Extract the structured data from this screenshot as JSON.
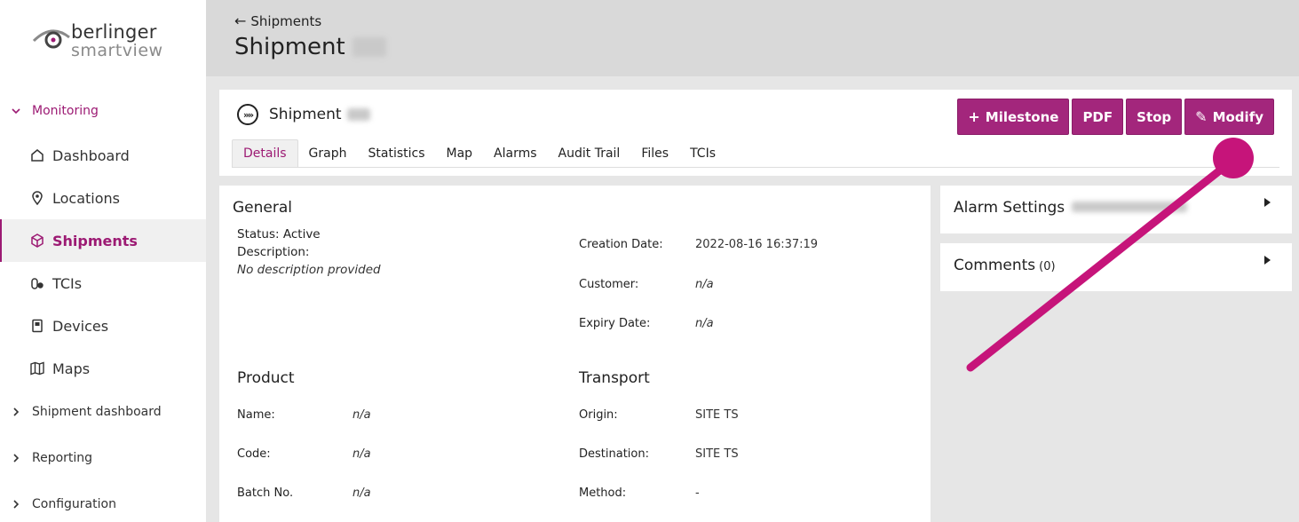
{
  "brand": {
    "word1": "berlinger",
    "word2": "smartview",
    "accent": "#9c1a73",
    "button": "#a3267c"
  },
  "sidebar": {
    "groups": [
      {
        "label": "Monitoring",
        "expanded": true
      },
      {
        "label": "Shipment dashboard",
        "expanded": false
      },
      {
        "label": "Reporting",
        "expanded": false
      },
      {
        "label": "Configuration",
        "expanded": false
      }
    ],
    "items": [
      {
        "label": "Dashboard",
        "icon": "home-icon"
      },
      {
        "label": "Locations",
        "icon": "location-pin-icon"
      },
      {
        "label": "Shipments",
        "icon": "package-icon",
        "active": true
      },
      {
        "label": "TCIs",
        "icon": "pills-icon"
      },
      {
        "label": "Devices",
        "icon": "device-icon"
      },
      {
        "label": "Maps",
        "icon": "map-icon"
      }
    ]
  },
  "header": {
    "back_label": "Shipments",
    "title": "Shipment"
  },
  "card": {
    "title": "Shipment",
    "actions": [
      {
        "label": "Milestone",
        "icon": "plus-icon"
      },
      {
        "label": "PDF"
      },
      {
        "label": "Stop"
      },
      {
        "label": "Modify",
        "icon": "pencil-icon"
      }
    ],
    "tabs": [
      "Details",
      "Graph",
      "Statistics",
      "Map",
      "Alarms",
      "Audit Trail",
      "Files",
      "TCIs"
    ],
    "active_tab": "Details"
  },
  "general": {
    "heading": "General",
    "status": "Status: Active",
    "description_label": "Description:",
    "description": "No description provided",
    "creation_date_label": "Creation Date:",
    "creation_date": "2022-08-16 16:37:19",
    "customer_label": "Customer:",
    "customer": "n/a",
    "expiry_label": "Expiry Date:",
    "expiry": "n/a"
  },
  "product": {
    "heading": "Product",
    "name_label": "Name:",
    "name": "n/a",
    "code_label": "Code:",
    "code": "n/a",
    "batch_label": "Batch No.",
    "batch": "n/a"
  },
  "transport": {
    "heading": "Transport",
    "origin_label": "Origin:",
    "origin": "SITE TS",
    "destination_label": "Destination:",
    "destination": "SITE TS",
    "method_label": "Method:",
    "method": "-"
  },
  "right": {
    "alarm_settings": "Alarm Settings",
    "comments": "Comments",
    "comments_count": "(0)"
  }
}
